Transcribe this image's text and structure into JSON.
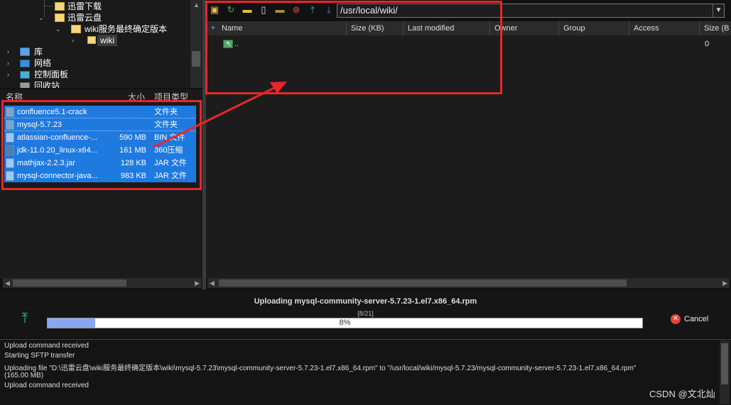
{
  "tree": {
    "items": [
      {
        "label": "迅雷下载"
      },
      {
        "label": "迅雷云盘"
      },
      {
        "label": "wiki服务最终确定版本"
      },
      {
        "label": "wiki"
      },
      {
        "label": "库"
      },
      {
        "label": "网络"
      },
      {
        "label": "控制面板"
      },
      {
        "label": "回收站"
      }
    ]
  },
  "local_list": {
    "headers": {
      "name": "名称",
      "size": "大小",
      "type": "项目类型"
    },
    "rows": [
      {
        "name": "confluence5.1-crack",
        "size": "",
        "type": "文件夹"
      },
      {
        "name": "mysql-5.7.23",
        "size": "",
        "type": "文件夹"
      },
      {
        "name": "atlassian-confluence-...",
        "size": "590 MB",
        "type": "BIN 文件"
      },
      {
        "name": "jdk-11.0.20_linux-x64...",
        "size": "161 MB",
        "type": "360压缩"
      },
      {
        "name": "mathjax-2.2.3.jar",
        "size": "128 KB",
        "type": "JAR 文件"
      },
      {
        "name": "mysql-connector-java...",
        "size": "983 KB",
        "type": "JAR 文件"
      }
    ]
  },
  "remote": {
    "path": "/usr/local/wiki/",
    "columns": [
      "Name",
      "Size (KB)",
      "Last modified",
      "Owner",
      "Group",
      "Access",
      "Size (B"
    ],
    "rows": [
      {
        "name": "..",
        "size_b": "0"
      }
    ]
  },
  "transfer": {
    "title": "Uploading mysql-community-server-5.7.23-1.el7.x86_64.rpm",
    "count": "[8/21]",
    "percent_label": "8%",
    "progress": 0.08,
    "cancel_label": "Cancel"
  },
  "log": {
    "lines": [
      "Upload command received",
      "Starting SFTP transfer",
      "Uploading file \"D:\\迅雷云盘\\wiki服务最终确定版本\\wiki\\mysql-5.7.23\\mysql-community-server-5.7.23-1.el7.x86_64.rpm\" to \"/usr/local/wiki/mysql-5.7.23/mysql-community-server-5.7.23-1.el7.x86_64.rpm\"",
      "(165.00 MB)",
      "Upload command received"
    ]
  },
  "watermark": "CSDN @文北灿",
  "colors": {
    "selection": "#1f7ae0",
    "highlight": "#e8262a",
    "progress_fill": "#88a6f2"
  }
}
